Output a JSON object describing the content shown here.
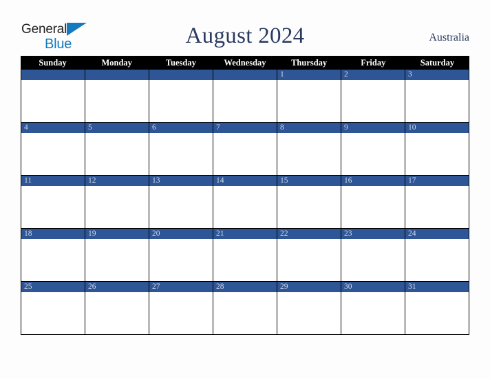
{
  "brand": {
    "name_part1": "General",
    "name_part2": "Blue",
    "triangle_icon": "triangle-icon",
    "accent_color": "#1479bd",
    "text_color": "#231f20"
  },
  "header": {
    "title": "August 2024",
    "region": "Australia",
    "title_color": "#2b3a60"
  },
  "calendar": {
    "month": "August",
    "year": "2024",
    "weekday_header_bg": "#000000",
    "weekday_header_color": "#ffffff",
    "day_bar_color": "#2e5595",
    "day_number_color": "#d5dce8",
    "cell_bg": "#ffffff",
    "border_color": "#000000",
    "weekdays": [
      "Sunday",
      "Monday",
      "Tuesday",
      "Wednesday",
      "Thursday",
      "Friday",
      "Saturday"
    ],
    "weeks": [
      [
        "",
        "",
        "",
        "",
        "1",
        "2",
        "3"
      ],
      [
        "4",
        "5",
        "6",
        "7",
        "8",
        "9",
        "10"
      ],
      [
        "11",
        "12",
        "13",
        "14",
        "15",
        "16",
        "17"
      ],
      [
        "18",
        "19",
        "20",
        "21",
        "22",
        "23",
        "24"
      ],
      [
        "25",
        "26",
        "27",
        "28",
        "29",
        "30",
        "31"
      ]
    ]
  }
}
